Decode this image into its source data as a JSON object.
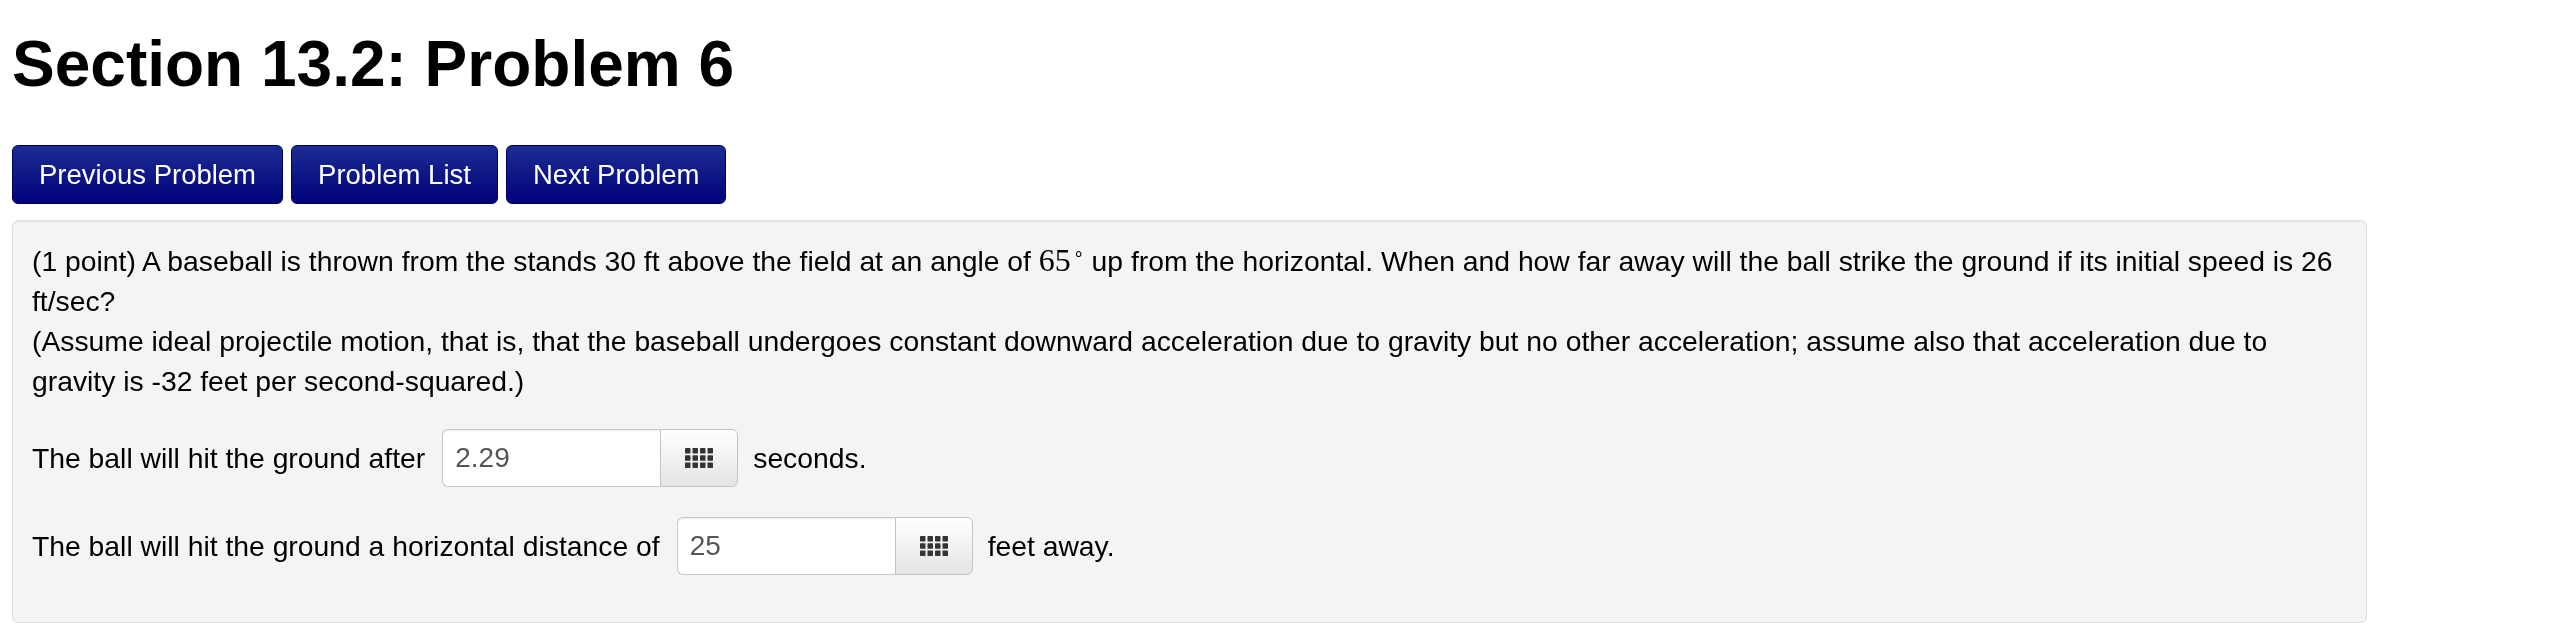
{
  "title": "Section 13.2: Problem 6",
  "nav_buttons": [
    "Previous Problem",
    "Problem List",
    "Next Problem"
  ],
  "problem": {
    "statement": [
      {
        "kind": "text",
        "text": "(1 point) A baseball is thrown from the stands 30 ft above the field at an angle of "
      },
      {
        "kind": "math",
        "text": "65$^{∘}$"
      },
      {
        "kind": "text",
        "text": " up from the horizontal. When and how far away will the ball strike the ground if its initial speed is 26 ft/sec?"
      }
    ],
    "note": "(Assume ideal projectile motion, that is, that the baseball undergoes constant downward acceleration due to gravity but no other acceleration; assume also that acceleration due to gravity is -32 feet per second-squared.)",
    "answers": [
      {
        "label": "The ball will hit the ground after",
        "value": "2.29",
        "units": "seconds."
      },
      {
        "label": "The ball will hit the ground a horizontal distance of",
        "value": "25",
        "units": "feet away."
      }
    ]
  }
}
